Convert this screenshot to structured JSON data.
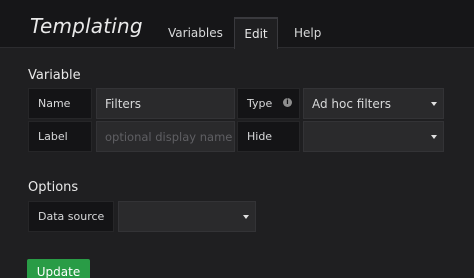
{
  "header": {
    "title": "Templating",
    "tabs": [
      {
        "label": "Variables"
      },
      {
        "label": "Edit"
      },
      {
        "label": "Help"
      }
    ]
  },
  "variable": {
    "section_title": "Variable",
    "name_label": "Name",
    "name_value": "Filters",
    "type_label": "Type",
    "type_value": "Ad hoc filters",
    "label_label": "Label",
    "label_placeholder": "optional display name",
    "hide_label": "Hide",
    "hide_value": ""
  },
  "options": {
    "section_title": "Options",
    "datasource_label": "Data source",
    "datasource_value": ""
  },
  "actions": {
    "update_label": "Update"
  },
  "colors": {
    "accent_green": "#299c46",
    "background": "#1f1f21"
  }
}
